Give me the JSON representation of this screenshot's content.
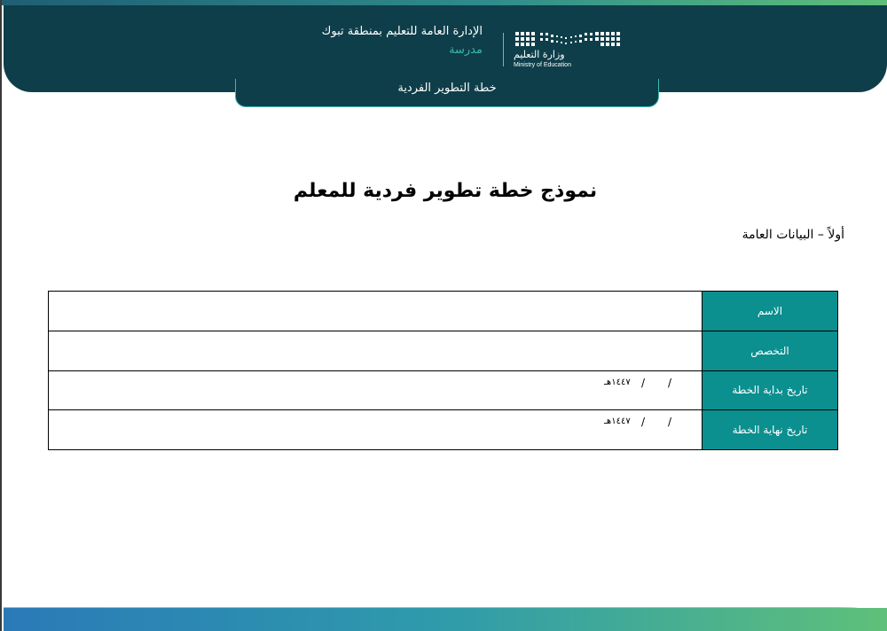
{
  "header": {
    "department": "الإدارة العامة للتعليم بمنطقة تبوك",
    "school_label": "مدرسة",
    "logo": {
      "arabic_name": "وزارة التعليم",
      "english_name": "Ministry of Education"
    },
    "plan_tab_label": "خطة التطوير الفردية"
  },
  "document": {
    "title": "نموذج خطة تطوير فردية للمعلم",
    "section_heading": "أولاً – البيانات العامة"
  },
  "table": {
    "rows": [
      {
        "label": "الاسم",
        "value": ""
      },
      {
        "label": "التخصص",
        "value": ""
      },
      {
        "label": "تاريخ بداية الخطة",
        "slash": "/",
        "year": "١٤٤٧هـ"
      },
      {
        "label": "تاريخ نهاية الخطة",
        "slash": "/",
        "year": "١٤٤٧هـ"
      }
    ]
  },
  "colors": {
    "header_band": "#0e3e4a",
    "label_cell": "#0b8f8f",
    "school_label": "#3cb8ad"
  }
}
